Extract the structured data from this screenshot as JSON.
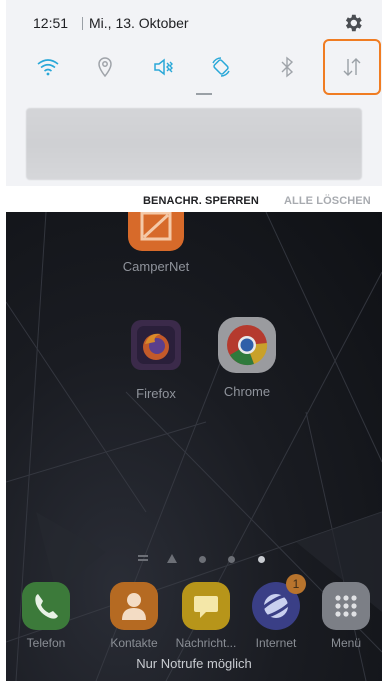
{
  "status_bar": {
    "time": "12:51",
    "date": "Mi., 13. Oktober",
    "settings_icon": "gear-icon"
  },
  "quick_settings": [
    {
      "name": "wifi",
      "icon": "wifi-icon",
      "active": true
    },
    {
      "name": "location",
      "icon": "location-icon",
      "active": false
    },
    {
      "name": "sound",
      "icon": "mute-icon",
      "active": true
    },
    {
      "name": "auto-rotate",
      "icon": "rotate-icon",
      "active": true
    },
    {
      "name": "bluetooth",
      "icon": "bluetooth-icon",
      "active": false
    },
    {
      "name": "mobile-data",
      "icon": "mobile-data-icon",
      "active": false
    }
  ],
  "notification_actions": {
    "block": "BENACHR. SPERREN",
    "clear_all": "ALLE LÖSCHEN"
  },
  "home_apps": [
    {
      "label": "CamperNet"
    },
    {
      "label": "Firefox"
    },
    {
      "label": "Chrome"
    }
  ],
  "dock": [
    {
      "label": "Telefon",
      "color": "#4caf50"
    },
    {
      "label": "Kontakte",
      "color": "#ef8a23"
    },
    {
      "label": "Nachricht...",
      "color": "#f5c518"
    },
    {
      "label": "Internet",
      "color": "#4a55c8",
      "badge": "1"
    },
    {
      "label": "Menü",
      "color": "#e8e8ea"
    }
  ],
  "page_indicator_count": 5,
  "emergency_text": "Nur Notrufe möglich",
  "colors": {
    "accent": "#2aa8d8",
    "highlight": "#f07c22"
  }
}
